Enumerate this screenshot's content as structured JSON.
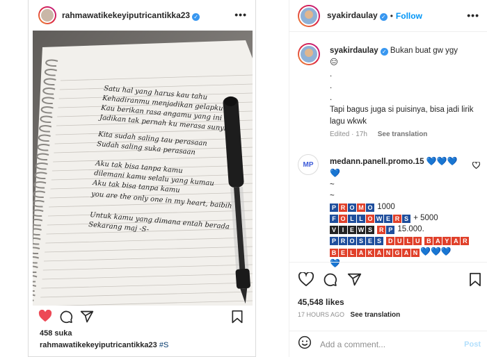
{
  "left_post": {
    "username": "rahmawatikekeyiputricantikka23",
    "likes": "458 suka",
    "caption_user": "rahmawatikekeyiputricantikka23",
    "caption_tag": "#S",
    "photo": {
      "handwriting": [
        "Satu hal yang harus kau tahu",
        "Kehadiranmu menjadikan gelapku",
        "Kau berikan rasa angamu yang ini",
        "Jadikan tak pernah ku merasa sunyi",
        "Kita sudah saling tau perasaan",
        "Sudah saling suka perasaan",
        "Aku tak bisa tanpa kamu",
        "dilemani kamu selalu yang kumau",
        "Aku tak bisa tanpa kamu",
        "you are the only one in my heart, baibih",
        "Untuk kamu yang dimana entah berada",
        "Sekarang maj -S-"
      ]
    }
  },
  "right_panel": {
    "username": "syakirdaulay",
    "dot": "•",
    "follow": "Follow",
    "main_comment": {
      "username": "syakirdaulay",
      "text": "Bukan buat gw ygy",
      "emoji": "😑",
      "dots": [
        ".",
        ".",
        "."
      ],
      "text2": "Tapi bagus juga si puisinya, bisa jadi lirik lagu wkwk",
      "edited": "Edited · 17h",
      "see_translation": "See translation"
    },
    "comment2": {
      "avatar_text": "MP",
      "username": "medann.panell.promo.15",
      "hearts": "💙💙💙",
      "heart4": "💙",
      "tilde1": "~",
      "tilde2": "~",
      "promo_word": "PROMO",
      "promo_value": "1000",
      "followers_word": "FOLLOWERS",
      "followers_value": "+ 5000",
      "views_word": "VIEWS",
      "rp_word": "RP",
      "price": "15.000.",
      "proses": "PROSES",
      "dulu": "DULU",
      "bayar": "BAYAR",
      "belakangan": "BELAKANGAN",
      "end_hearts": "💙💙💙",
      "last_heart": "💙"
    },
    "likes": "45,548 likes",
    "time": "17 HOURS AGO",
    "see_translation": "See translation",
    "add_comment_placeholder": "Add a comment...",
    "post_label": "Post"
  },
  "colors": {
    "brand_blue": "#0095f6",
    "like_red": "#ed4956",
    "verified_blue": "#3897f0"
  },
  "icons": [
    "heart-icon",
    "comment-icon",
    "share-icon",
    "bookmark-icon",
    "emoji-icon",
    "more-icon",
    "verified-icon"
  ]
}
